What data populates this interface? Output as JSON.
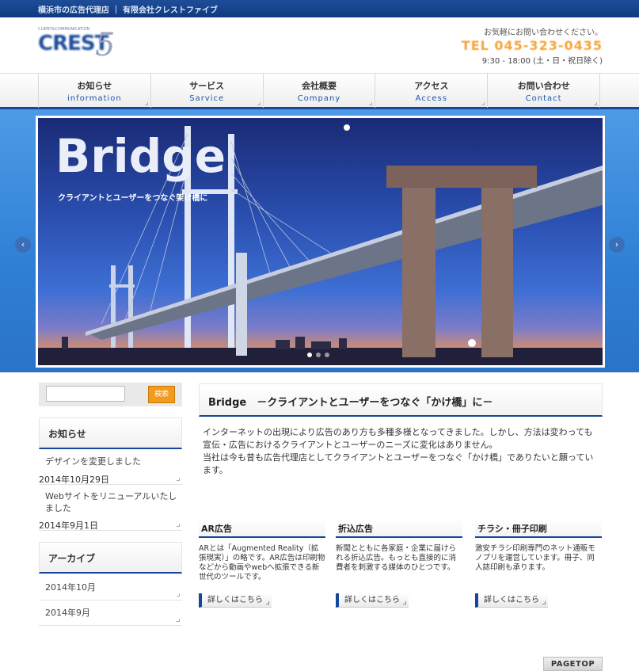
{
  "topbar": {
    "text": "横浜市の広告代理店 ｜ 有限会社クレストファイブ"
  },
  "logo": {
    "small_text": "CLIENT&COMMUNICATION",
    "word": "CREST",
    "mark": "5"
  },
  "header_contact": {
    "note": "お気軽にお問い合わせください。",
    "tel": "TEL 045-323-0435",
    "hours": "9:30 - 18:00 (土・日・祝日除く)"
  },
  "nav": {
    "items": [
      {
        "jp": "お知らせ",
        "en": "information"
      },
      {
        "jp": "サービス",
        "en": "Sarvice"
      },
      {
        "jp": "会社概要",
        "en": "Company"
      },
      {
        "jp": "アクセス",
        "en": "Access"
      },
      {
        "jp": "お問い合わせ",
        "en": "Contact"
      }
    ]
  },
  "hero": {
    "title": "Bridge",
    "subtitle": "クライアントとユーザーをつなぐ架け橋に",
    "prev_icon": "chevron-left-icon",
    "next_icon": "chevron-right-icon",
    "slide_count": 3,
    "active_slide": 1
  },
  "search": {
    "placeholder": "",
    "button": "検索"
  },
  "sidebar": {
    "news_title": "お知らせ",
    "news": [
      {
        "title": "デザインを変更しました",
        "date": "2014年10月29日"
      },
      {
        "title": "Webサイトをリニューアルいたしました",
        "date": "2014年9月1日"
      }
    ],
    "archive_title": "アーカイブ",
    "archive": [
      "2014年10月",
      "2014年9月"
    ]
  },
  "main": {
    "heading": "Bridge　－クライアントとユーザーをつなぐ「かけ橋」に－",
    "intro": [
      "インターネットの出現により広告のあり方も多種多様となってきました。しかし、方法は変わっても",
      "宣伝・広告におけるクライアントとユーザーのニーズに変化はありません。",
      "当社は今も昔も広告代理店としてクライアントとユーザーをつなぐ「かけ橋」でありたいと願っています。"
    ],
    "services": [
      {
        "title": "AR広告",
        "text": "ARとは「Augmented Reality（拡張現実）」の略です。AR広告は印刷物などから動画やwebへ拡張できる新世代のツールです。",
        "button": "詳しくはこちら"
      },
      {
        "title": "折込広告",
        "text": "新聞とともに各家庭・企業に届けられる折込広告。もっとも直接的に消費者を刺激する媒体のひとつです。",
        "button": "詳しくはこちら"
      },
      {
        "title": "チラシ・冊子印刷",
        "text": "激安チラシ印刷専門のネット通販モノプリを運営しています。冊子、同人誌印刷も承ります。",
        "button": "詳しくはこちら"
      }
    ]
  },
  "pagetop": "PAGETOP"
}
